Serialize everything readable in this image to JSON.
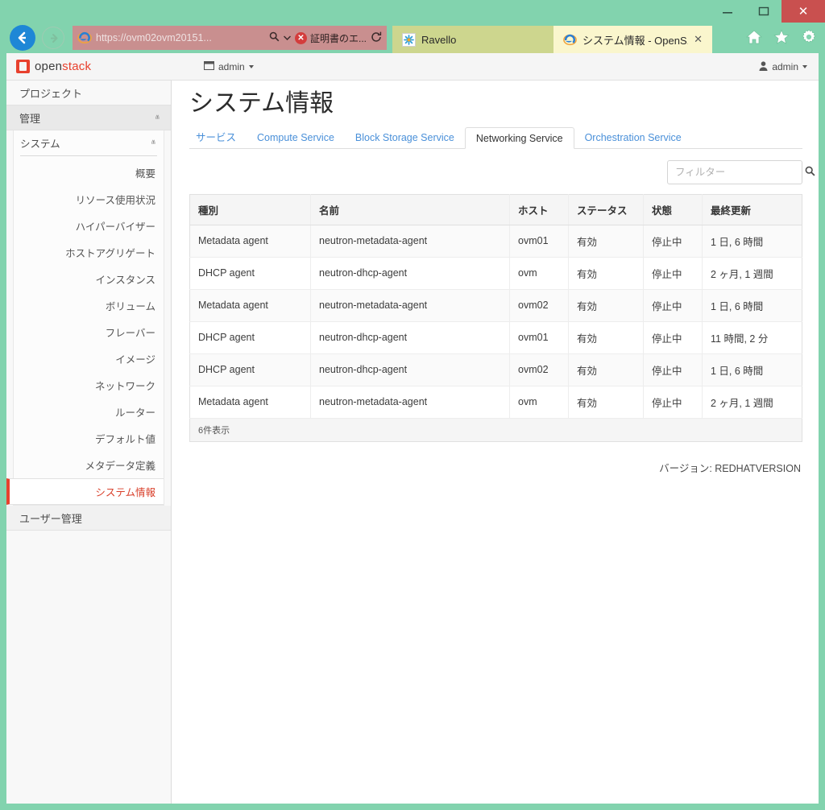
{
  "browser": {
    "window_controls": {
      "minimize": "—",
      "maximize": "❐",
      "close": "✕"
    },
    "back_label": "←",
    "forward_label": "→",
    "address": {
      "url": "https://ovm02ovm20151...",
      "search_icon": "search-icon",
      "dropdown_caret": "▼",
      "cert_error_badge": "✕",
      "cert_error_text": "証明書のエ...",
      "refresh_icon": "↻"
    },
    "tabs": [
      {
        "title": "Ravello",
        "favicon": "ravello-icon",
        "active": false,
        "close": ""
      },
      {
        "title": "システム情報 - OpenS...",
        "favicon": "ie-icon",
        "active": true,
        "close": "✕"
      }
    ],
    "toolbar_icons": [
      "home-icon",
      "favorites-star-icon",
      "settings-gear-icon"
    ]
  },
  "os_header": {
    "logo_open": "open",
    "logo_stack": "stack",
    "project_menu": "admin",
    "user_menu": "admin"
  },
  "sidebar": {
    "groups": [
      {
        "label": "プロジェクト",
        "chevron": "ⱟ",
        "expanded": false
      },
      {
        "label": "管理",
        "chevron": "ⱞ",
        "expanded": true
      }
    ],
    "subsection": {
      "label": "システム",
      "chevron": "ⱞ"
    },
    "items": [
      {
        "label": "概要",
        "active": false
      },
      {
        "label": "リソース使用状況",
        "active": false
      },
      {
        "label": "ハイパーバイザー",
        "active": false
      },
      {
        "label": "ホストアグリゲート",
        "active": false
      },
      {
        "label": "インスタンス",
        "active": false
      },
      {
        "label": "ボリューム",
        "active": false
      },
      {
        "label": "フレーバー",
        "active": false
      },
      {
        "label": "イメージ",
        "active": false
      },
      {
        "label": "ネットワーク",
        "active": false
      },
      {
        "label": "ルーター",
        "active": false
      },
      {
        "label": "デフォルト値",
        "active": false
      },
      {
        "label": "メタデータ定義",
        "active": false
      },
      {
        "label": "システム情報",
        "active": true
      }
    ],
    "bottom_group": {
      "label": "ユーザー管理",
      "chevron": "ⱟ"
    }
  },
  "main": {
    "title": "システム情報",
    "tabs": [
      {
        "label": "サービス",
        "active": false
      },
      {
        "label": "Compute Service",
        "active": false
      },
      {
        "label": "Block Storage Service",
        "active": false
      },
      {
        "label": "Networking Service",
        "active": true
      },
      {
        "label": "Orchestration Service",
        "active": false
      }
    ],
    "filter": {
      "placeholder": "フィルター",
      "value": "",
      "icon": "search-icon"
    },
    "table": {
      "headers": [
        "種別",
        "名前",
        "ホスト",
        "ステータス",
        "状態",
        "最終更新"
      ],
      "rows": [
        [
          "Metadata agent",
          "neutron-metadata-agent",
          "ovm01",
          "有効",
          "停止中",
          "1 日, 6 時間"
        ],
        [
          "DHCP agent",
          "neutron-dhcp-agent",
          "ovm",
          "有効",
          "停止中",
          "2 ヶ月, 1 週間"
        ],
        [
          "Metadata agent",
          "neutron-metadata-agent",
          "ovm02",
          "有効",
          "停止中",
          "1 日, 6 時間"
        ],
        [
          "DHCP agent",
          "neutron-dhcp-agent",
          "ovm01",
          "有効",
          "停止中",
          "11 時間, 2 分"
        ],
        [
          "DHCP agent",
          "neutron-dhcp-agent",
          "ovm02",
          "有効",
          "停止中",
          "1 日, 6 時間"
        ],
        [
          "Metadata agent",
          "neutron-metadata-agent",
          "ovm",
          "有効",
          "停止中",
          "2 ヶ月, 1 週間"
        ]
      ],
      "footer": "6件表示"
    },
    "version": "バージョン: REDHATVERSION"
  },
  "colors": {
    "window_frame": "#82d3ae",
    "close_button": "#c9504f",
    "accent_red": "#e8412e",
    "link_blue": "#4a90d9",
    "address_bar": "#c98f8f",
    "tab_inactive": "#cdd68e",
    "tab_active": "#faf6cd"
  }
}
